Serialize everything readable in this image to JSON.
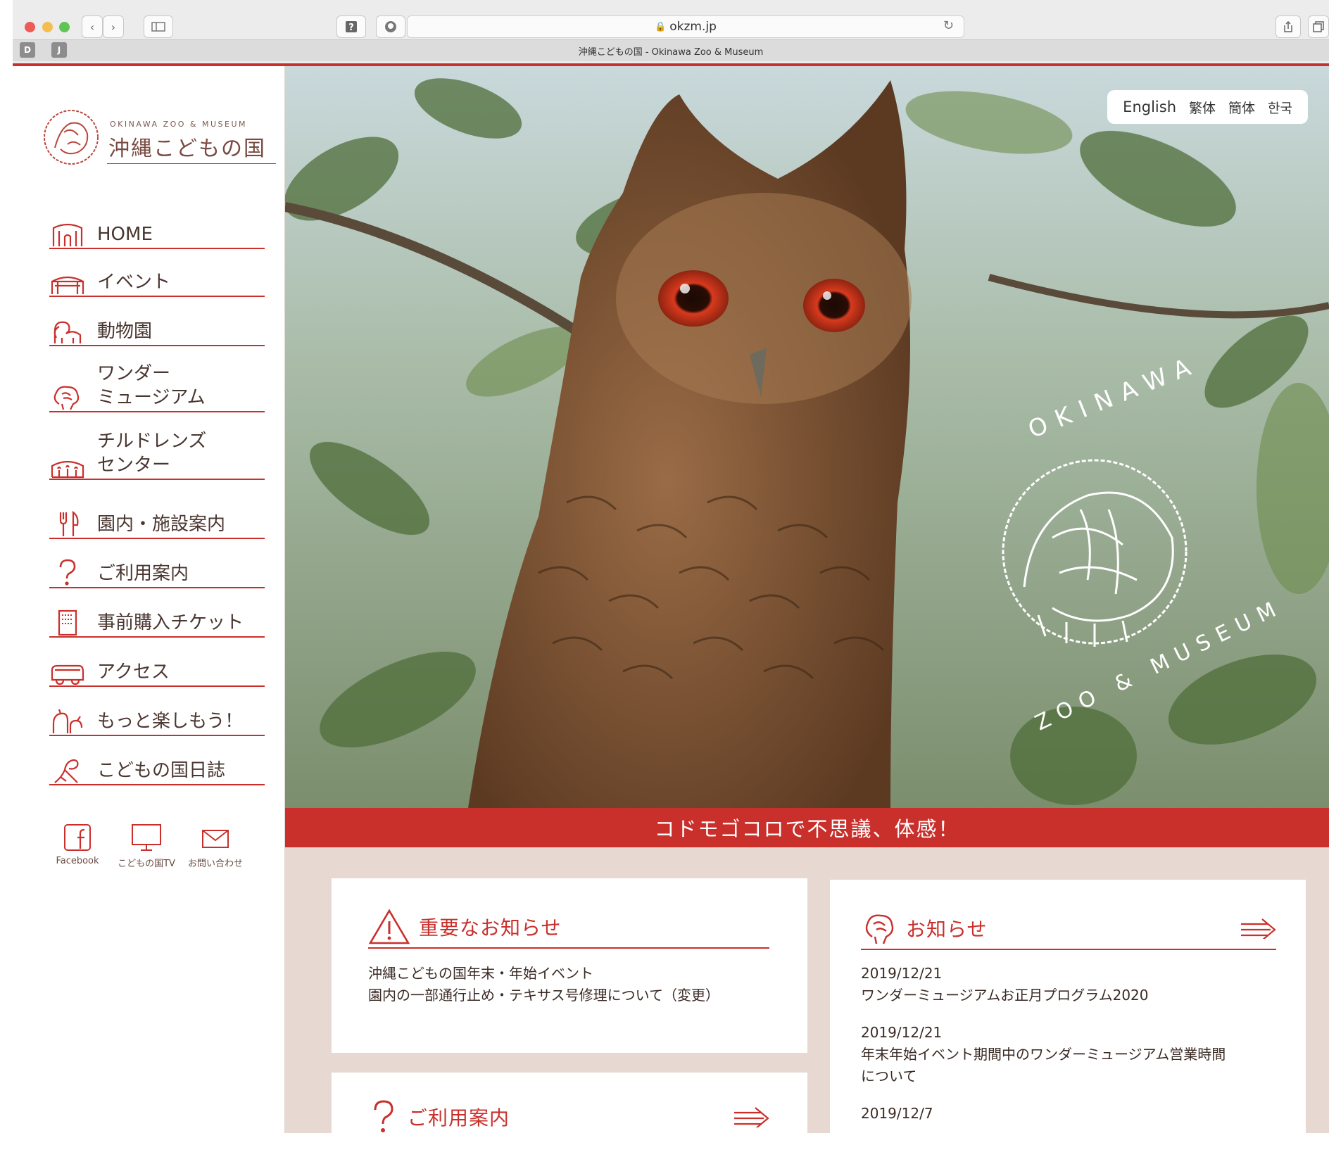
{
  "browser": {
    "url": "okzm.jp",
    "tab_title": "沖縄こどもの国 - Okinawa Zoo & Museum",
    "fav1": "D",
    "fav2": "J"
  },
  "logo": {
    "en": "OKINAWA ZOO & MUSEUM",
    "jp": "沖縄こどもの国"
  },
  "nav": [
    {
      "label": "HOME",
      "icon": "gate-icon"
    },
    {
      "label": "イベント",
      "icon": "stage-icon"
    },
    {
      "label": "動物園",
      "icon": "elephant-icon"
    },
    {
      "label": "ワンダー",
      "label2": "ミュージアム",
      "icon": "brain-icon"
    },
    {
      "label": "チルドレンズ",
      "label2": "センター",
      "icon": "children-icon"
    },
    {
      "label": "園内・施設案内",
      "icon": "fork-knife-icon"
    },
    {
      "label": "ご利用案内",
      "icon": "question-icon"
    },
    {
      "label": "事前購入チケット",
      "icon": "ticket-icon"
    },
    {
      "label": "アクセス",
      "icon": "bus-icon"
    },
    {
      "label": "もっと楽しもう！",
      "icon": "animals-icon"
    },
    {
      "label": "こどもの国日誌",
      "icon": "diary-icon"
    }
  ],
  "social": {
    "facebook": "Facebook",
    "tv": "こどもの国TV",
    "contact": "お問い合わせ"
  },
  "languages": [
    "English",
    "繁体",
    "簡体",
    "한국"
  ],
  "hero": {
    "logo_top": "OKINAWA",
    "logo_bottom": "ZOO & MUSEUM"
  },
  "tagline": "コドモゴコロで不思議、体感！",
  "important": {
    "title": "重要なお知らせ",
    "items": [
      "沖縄こどもの国年末・年始イベント",
      "園内の一部通行止め・テキサス号修理について（変更）"
    ]
  },
  "usage": {
    "title": "ご利用案内"
  },
  "news": {
    "title": "お知らせ",
    "items": [
      {
        "date": "2019/12/21",
        "text": "ワンダーミュージアムお正月プログラム2020"
      },
      {
        "date": "2019/12/21",
        "text": "年末年始イベント期間中のワンダーミュージアム営業時間",
        "text2": "について"
      },
      {
        "date": "2019/12/7",
        "text": ""
      }
    ]
  }
}
